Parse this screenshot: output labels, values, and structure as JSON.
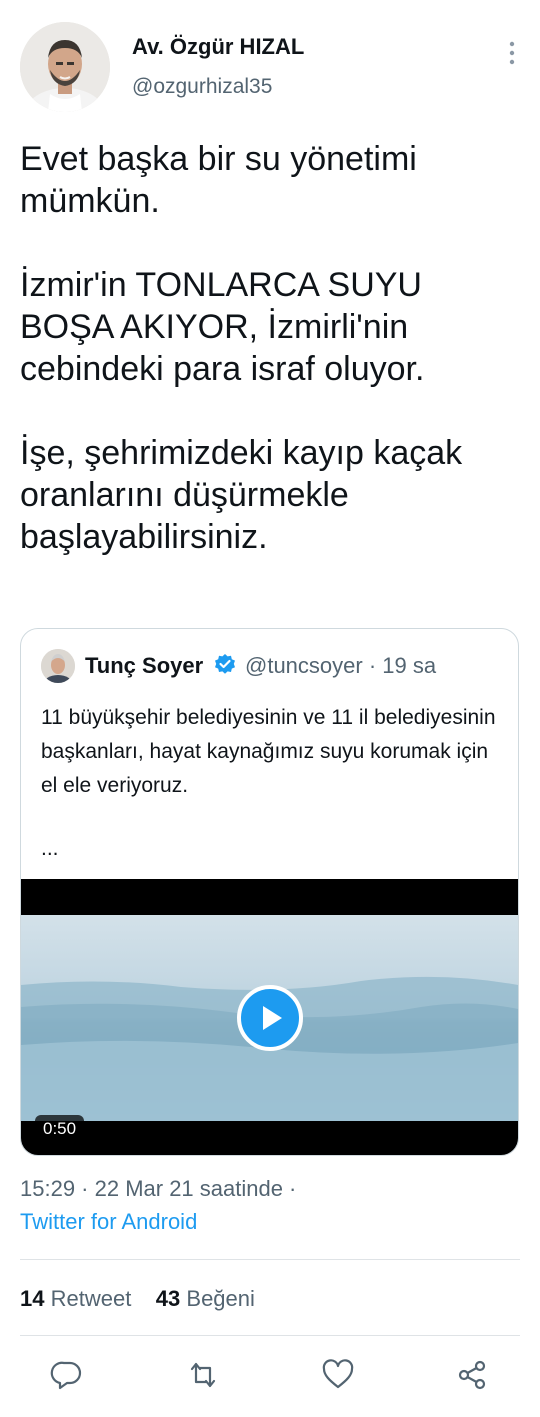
{
  "author": {
    "name": "Av. Özgür HIZAL",
    "handle": "@ozgurhizal35",
    "avatar_icon": "profile-photo"
  },
  "tweet": {
    "text": "Evet başka bir su yönetimi mümkün.\n\nİzmir'in TONLARCA SUYU BOŞA AKIYOR, İzmirli'nin cebindeki para israf oluyor.\n\nİşe, şehrimizdeki kayıp kaçak oranlarını düşürmekle başlayabilirsiniz."
  },
  "quoted_tweet": {
    "name": "Tunç Soyer",
    "handle_time": "@tuncsoyer · 19 sa",
    "text": "11 büyükşehir belediyesinin ve 11 il belediyesinin başkanları, hayat kaynağımız suyu korumak için el ele veriyoruz.",
    "ellipsis": "...",
    "video_duration": "0:50"
  },
  "meta": {
    "timestamp": "15:29 · 22 Mar 21 saatinde ·",
    "source": "Twitter for Android"
  },
  "stats": {
    "retweets_count": "14",
    "retweets_label": "Retweet",
    "likes_count": "43",
    "likes_label": "Beğeni"
  },
  "colors": {
    "accent": "#1d9bf0",
    "text": "#0f1419",
    "secondary": "#536471",
    "border": "#cfd9de"
  }
}
